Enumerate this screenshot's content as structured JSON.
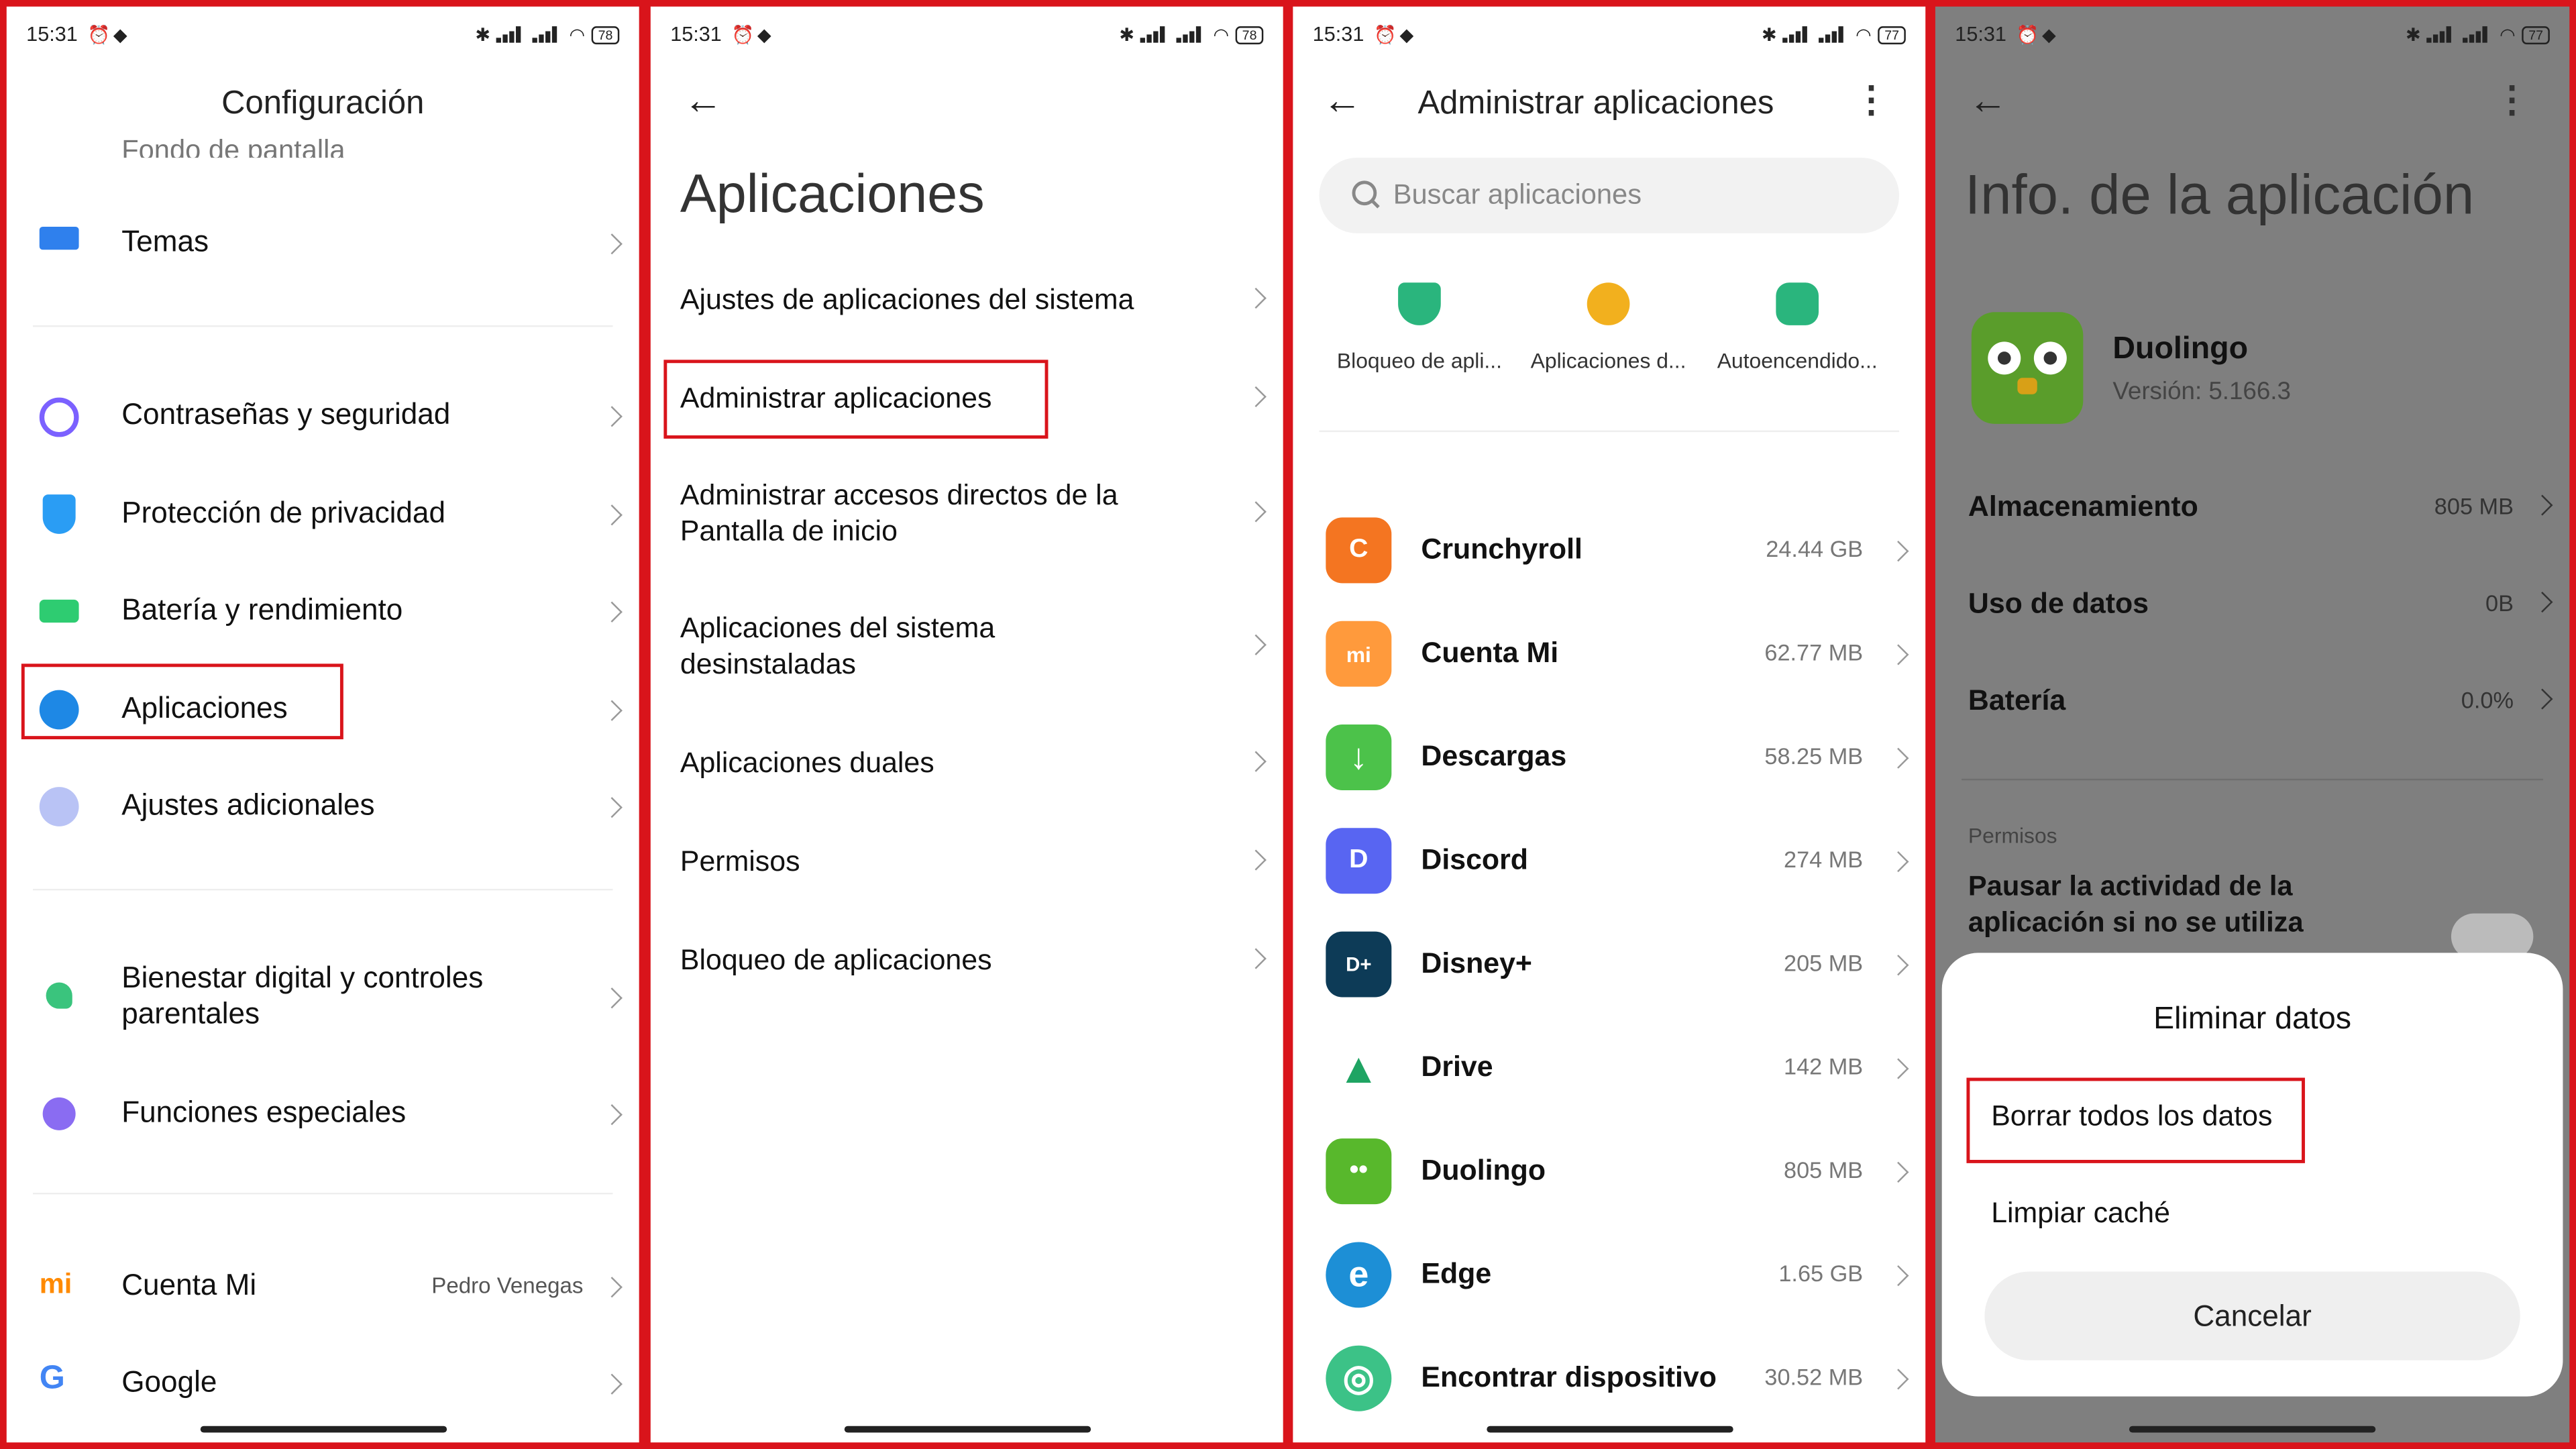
{
  "status": {
    "time": "15:31",
    "battery": [
      "78",
      "78",
      "77",
      "77"
    ]
  },
  "panel1": {
    "title": "Configuración",
    "cut_item": "Fondo de pantalla",
    "items": [
      {
        "label": "Temas",
        "icon": "themes-icon",
        "color": "#2f80ed"
      },
      {
        "label": "Contraseñas y seguridad",
        "icon": "fingerprint-icon",
        "color": "#7b61ff"
      },
      {
        "label": "Protección de privacidad",
        "icon": "privacy-shield-icon",
        "color": "#2a9df4"
      },
      {
        "label": "Batería y rendimiento",
        "icon": "battery-icon",
        "color": "#2ecc71"
      },
      {
        "label": "Aplicaciones",
        "icon": "gear-icon",
        "color": "#1e88e5"
      },
      {
        "label": "Ajustes adicionales",
        "icon": "more-dots-icon",
        "color": "#9aa9ee"
      },
      {
        "label": "Bienestar digital y controles parentales",
        "icon": "wellbeing-icon",
        "color": "#3ac47d"
      },
      {
        "label": "Funciones especiales",
        "icon": "special-features-icon",
        "color": "#8a6cf2"
      },
      {
        "label": "Cuenta Mi",
        "value": "Pedro Venegas",
        "icon": "mi-account-icon",
        "color": "#ff8a00"
      },
      {
        "label": "Google",
        "icon": "google-icon",
        "color": "#4285f4"
      }
    ]
  },
  "panel2": {
    "title": "Aplicaciones",
    "items": [
      "Ajustes de aplicaciones del sistema",
      "Administrar aplicaciones",
      "Administrar accesos directos de la Pantalla de inicio",
      "Aplicaciones del sistema desinstaladas",
      "Aplicaciones duales",
      "Permisos",
      "Bloqueo de aplicaciones"
    ]
  },
  "panel3": {
    "title": "Administrar aplicaciones",
    "search_placeholder": "Buscar aplicaciones",
    "quick_actions": [
      {
        "label": "Bloqueo de apli...",
        "color": "#2ab57d"
      },
      {
        "label": "Aplicaciones d...",
        "color": "#f2b01e"
      },
      {
        "label": "Autoencendido...",
        "color": "#2ab57d"
      }
    ],
    "apps": [
      {
        "name": "Crunchyroll",
        "size": "24.44 GB",
        "color": "#f47521",
        "glyph": "C"
      },
      {
        "name": "Cuenta Mi",
        "size": "62.77 MB",
        "color": "#ff9a3c",
        "glyph": "mi"
      },
      {
        "name": "Descargas",
        "size": "58.25 MB",
        "color": "#4cc24a",
        "glyph": "↓"
      },
      {
        "name": "Discord",
        "size": "274 MB",
        "color": "#5865f2",
        "glyph": "D"
      },
      {
        "name": "Disney+",
        "size": "205 MB",
        "color": "#0d3b57",
        "glyph": "D+"
      },
      {
        "name": "Drive",
        "size": "142 MB",
        "color": "#ffffff",
        "glyph": "▲"
      },
      {
        "name": "Duolingo",
        "size": "805 MB",
        "color": "#58b82c",
        "glyph": "••"
      },
      {
        "name": "Edge",
        "size": "1.65 GB",
        "color": "#1d8fd6",
        "glyph": "e"
      },
      {
        "name": "Encontrar dispositivo",
        "size": "30.52 MB",
        "color": "#3cc287",
        "glyph": "◎"
      }
    ]
  },
  "panel4": {
    "title": "Info. de la aplicación",
    "app_name": "Duolingo",
    "version": "Versión: 5.166.3",
    "rows": [
      {
        "label": "Almacenamiento",
        "value": "805 MB"
      },
      {
        "label": "Uso de datos",
        "value": "0B"
      },
      {
        "label": "Batería",
        "value": "0.0%"
      }
    ],
    "permissions_header": "Permisos",
    "permission_item": "Pausar la actividad de la aplicación si no se utiliza",
    "sheet": {
      "title": "Eliminar datos",
      "options": [
        "Borrar todos los datos",
        "Limpiar caché"
      ],
      "cancel": "Cancelar"
    }
  },
  "accent": "#d9141b"
}
